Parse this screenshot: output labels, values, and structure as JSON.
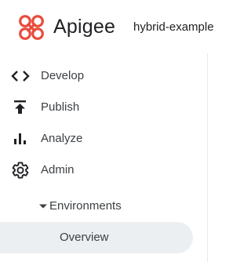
{
  "header": {
    "brand": "Apigee",
    "project": "hybrid-example",
    "logo_icon": "apigee-logo-icon",
    "logo_color": "#e94b3c"
  },
  "nav": {
    "items": [
      {
        "label": "Develop",
        "icon": "code-icon"
      },
      {
        "label": "Publish",
        "icon": "publish-icon"
      },
      {
        "label": "Analyze",
        "icon": "bar-chart-icon"
      },
      {
        "label": "Admin",
        "icon": "gear-icon"
      }
    ],
    "environments": {
      "label": "Environments",
      "expanded": true
    },
    "overview": {
      "label": "Overview",
      "selected": true
    }
  },
  "colors": {
    "selected_bg": "#eceff1",
    "text": "#3c4043"
  }
}
